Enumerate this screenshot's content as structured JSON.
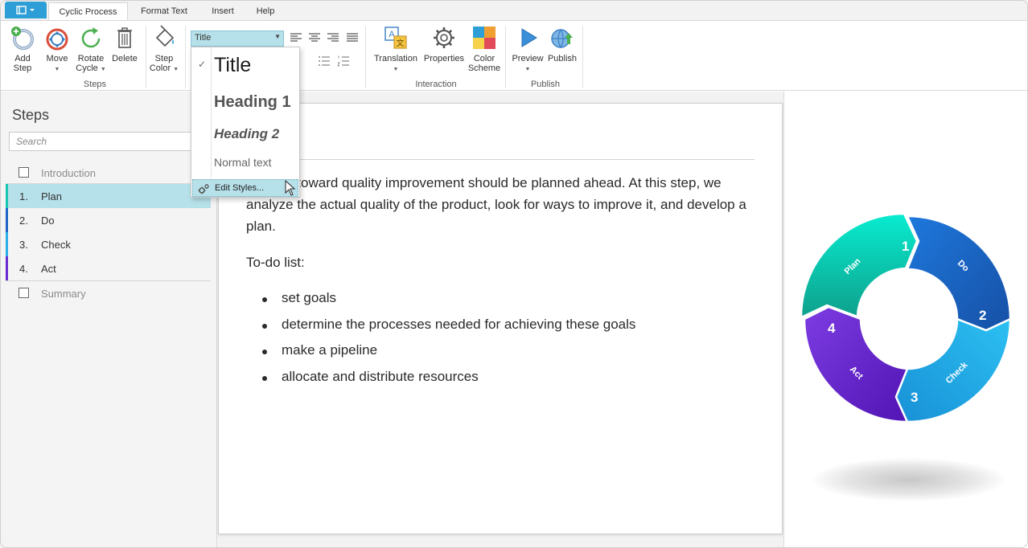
{
  "tabs": [
    {
      "label": "Cyclic Process",
      "active": true
    },
    {
      "label": "Format Text",
      "active": false
    },
    {
      "label": "Insert",
      "active": false
    },
    {
      "label": "Help",
      "active": false
    }
  ],
  "ribbon": {
    "steps_group": {
      "label": "Steps",
      "add": "Add Step",
      "move": "Move",
      "rotate": "Rotate Cycle",
      "delete": "Delete"
    },
    "step_color": "Step Color",
    "style_select": {
      "value": "Title"
    },
    "interaction_group": {
      "label": "Interaction",
      "translation": "Translation",
      "properties": "Properties",
      "color_scheme": "Color Scheme"
    },
    "publish_group": {
      "label": "Publish",
      "preview": "Preview",
      "publish": "Publish"
    }
  },
  "style_dropdown": {
    "items": [
      {
        "label": "Title",
        "checked": true
      },
      {
        "label": "Heading 1"
      },
      {
        "label": "Heading 2"
      },
      {
        "label": "Normal text"
      }
    ],
    "edit_styles": "Edit Styles..."
  },
  "steps_pane": {
    "title": "Steps",
    "search_placeholder": "Search",
    "intro": "Introduction",
    "summary": "Summary",
    "steps": [
      {
        "num": "1.",
        "name": "Plan",
        "color": "#17c6b0",
        "active": true
      },
      {
        "num": "2.",
        "name": "Do",
        "color": "#1e64c8"
      },
      {
        "num": "3.",
        "name": "Check",
        "color": "#2aaee6"
      },
      {
        "num": "4.",
        "name": "Act",
        "color": "#6a2bd0"
      }
    ]
  },
  "editor": {
    "paragraph": "...ctions toward quality improvement should be planned ahead. At this step, we analyze the actual quality of the product, look for ways to improve it, and develop a plan.",
    "todo_heading": "To-do list:",
    "list": [
      "set goals",
      "determine the processes needed for achieving these goals",
      "make a pipeline",
      "allocate and distribute resources"
    ]
  },
  "cycle": {
    "segments": [
      {
        "num": "1",
        "name": "Plan",
        "color_start": "#08e8c8",
        "color_end": "#0aa890"
      },
      {
        "num": "2",
        "name": "Do",
        "color_start": "#1e70d8",
        "color_end": "#1550a8"
      },
      {
        "num": "3",
        "name": "Check",
        "color_start": "#2ab8ee",
        "color_end": "#1a98d8"
      },
      {
        "num": "4",
        "name": "Act",
        "color_start": "#7a3ae0",
        "color_end": "#5518b8"
      }
    ]
  }
}
